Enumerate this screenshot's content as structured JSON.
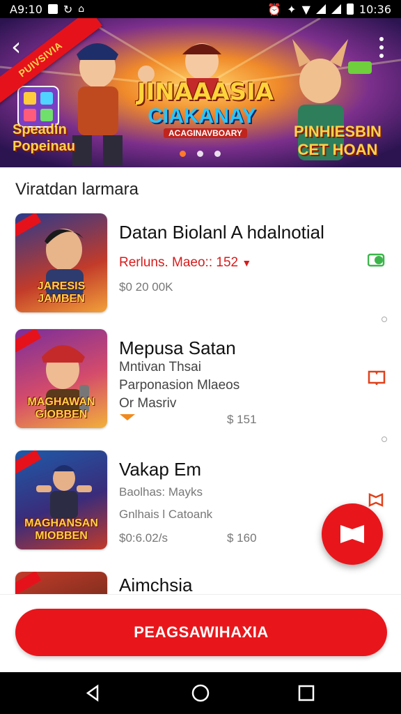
{
  "status_bar": {
    "left_time": "A9:10",
    "clock": "10:36"
  },
  "banner": {
    "ribbon_text": "PUIVSIVIA",
    "title": "JINAAASIA",
    "subtitle": "CIAKANAY",
    "tag": "ACAGINAVBOARY",
    "left_text": "Speadin Popeinau",
    "right_text": "PINHIESBIN CET HOAN",
    "slide_count": 3,
    "active_slide": 1
  },
  "section_title": "Viratdan larmara",
  "items": [
    {
      "thumb_label": "JARESIS JAMBEN",
      "title": "Datan Biolanl A hdalnotial",
      "line1": "Rerluns. Maeo:: 152",
      "line2": "$0 20 00K",
      "price": ""
    },
    {
      "thumb_label": "MAGHAWAN GIOBBEN",
      "title": "Mepusa Satan",
      "line1": "Mntivan Thsai",
      "line2": "Parponasion Mlaeos",
      "line3": "Or Masriv",
      "price": "$ 151"
    },
    {
      "thumb_label": "MAGHANSAN MIOBBEN",
      "title": "Vakap Em",
      "line1": "Baolhas: Mayks",
      "line2": "Gnlhais l Catoank",
      "line3": "$0:6.02/s",
      "price": "$ 160"
    },
    {
      "thumb_label": "",
      "title": "Aimchsia"
    }
  ],
  "cta": {
    "label": "PEAGSAWIHAXIA"
  },
  "colors": {
    "accent": "#e8161b",
    "banner_bg": "#5b2a86",
    "price_red": "#d81b1b"
  },
  "icons": [
    "back-arrow-icon",
    "more-vert-icon",
    "chat-bubble-icon",
    "book-icon",
    "flag-icon",
    "triangle-back-icon",
    "circle-home-icon",
    "square-recents-icon"
  ]
}
